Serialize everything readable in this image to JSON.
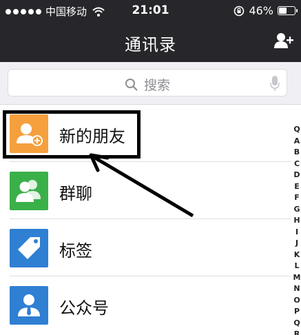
{
  "status_bar": {
    "carrier": "中国移动",
    "time": "21:01",
    "battery": "46%",
    "battery_level": 0.46
  },
  "nav": {
    "title": "通讯录",
    "add_icon": "add-contact-icon"
  },
  "search": {
    "placeholder": "搜索"
  },
  "rows": [
    {
      "label": "新的朋友",
      "icon": "new-friends-icon",
      "color": "#f5a03d"
    },
    {
      "label": "群聊",
      "icon": "group-chat-icon",
      "color": "#3ab049"
    },
    {
      "label": "标签",
      "icon": "tag-icon",
      "color": "#2f7fd3"
    },
    {
      "label": "公众号",
      "icon": "official-account-icon",
      "color": "#2f7fd3"
    }
  ],
  "index": [
    "Q",
    "A",
    "B",
    "C",
    "D",
    "E",
    "F",
    "G",
    "H",
    "I",
    "J",
    "K",
    "L",
    "M",
    "N",
    "O",
    "P",
    "Q",
    "R"
  ]
}
